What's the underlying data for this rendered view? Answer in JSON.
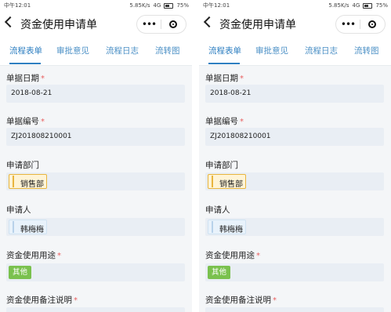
{
  "status": {
    "time": "中午12:01",
    "speed": "5.85K/s",
    "network": "4G",
    "battery": "75%"
  },
  "nav": {
    "title": "资金使用申请单",
    "more": "•••"
  },
  "tabs": [
    {
      "label": "流程表单",
      "active": true
    },
    {
      "label": "审批意见",
      "active": false
    },
    {
      "label": "流程日志",
      "active": false
    },
    {
      "label": "流转图",
      "active": false
    }
  ],
  "fields": {
    "date": {
      "label": "单据日期",
      "required": "*",
      "value": "2018-08-21"
    },
    "number": {
      "label": "单据编号",
      "required": "*",
      "value": "ZJ201808210001"
    },
    "dept": {
      "label": "申请部门",
      "value": "销售部"
    },
    "applicant": {
      "label": "申请人",
      "value": "韩梅梅"
    },
    "purpose": {
      "label": "资金使用用途",
      "required": "*",
      "value": "其他"
    },
    "remark": {
      "label": "资金使用备注说明",
      "required": "*"
    }
  },
  "colors": {
    "accent": "#2e7fc1",
    "required": "#e86060",
    "green_tag": "#7ac14e",
    "yellow_tag_border": "#e8b53e"
  }
}
